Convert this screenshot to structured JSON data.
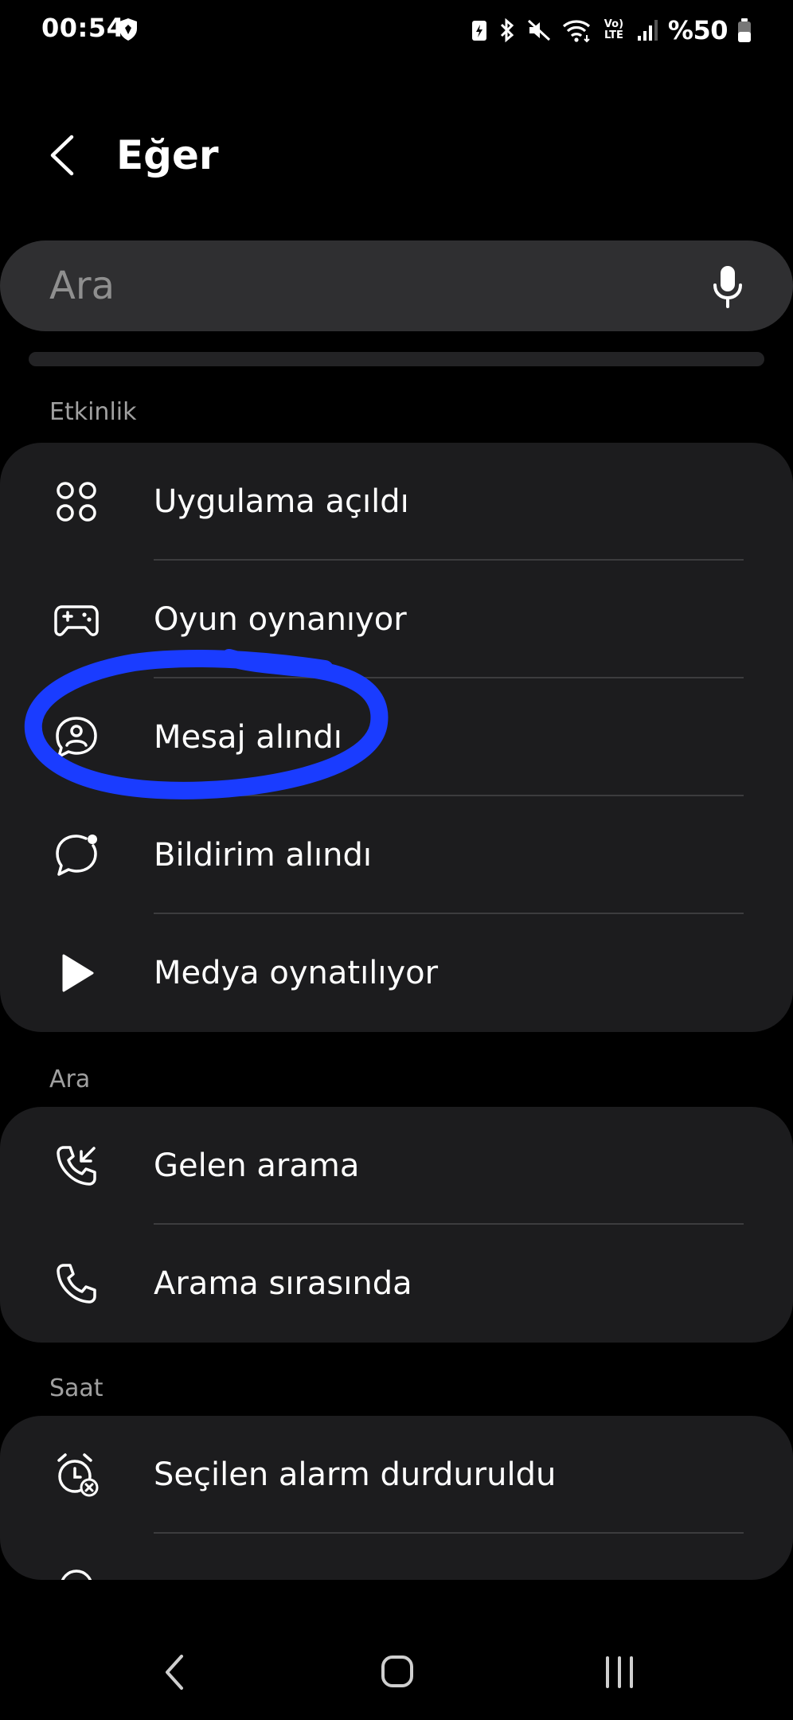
{
  "status_bar": {
    "time": "00:54",
    "battery": "%50",
    "network": "Vo) LTE"
  },
  "header": {
    "title": "Eğer"
  },
  "search": {
    "placeholder": "Ara"
  },
  "sections": [
    {
      "label": "Etkinlik",
      "items": [
        {
          "label": "Uygulama açıldı",
          "icon": "apps-icon"
        },
        {
          "label": "Oyun oynanıyor",
          "icon": "gamepad-icon"
        },
        {
          "label": "Mesaj alındı",
          "icon": "message-person-icon"
        },
        {
          "label": "Bildirim alındı",
          "icon": "notification-bubble-icon"
        },
        {
          "label": "Medya oynatılıyor",
          "icon": "play-icon"
        }
      ]
    },
    {
      "label": "Ara",
      "items": [
        {
          "label": "Gelen arama",
          "icon": "incoming-call-icon"
        },
        {
          "label": "Arama sırasında",
          "icon": "phone-icon"
        }
      ]
    },
    {
      "label": "Saat",
      "items": [
        {
          "label": "Seçilen alarm durduruldu",
          "icon": "alarm-off-icon"
        }
      ]
    }
  ],
  "colors": {
    "background": "#000000",
    "card": "#1c1c1e",
    "search": "#2f2f31",
    "annotation": "#1a3cff"
  }
}
